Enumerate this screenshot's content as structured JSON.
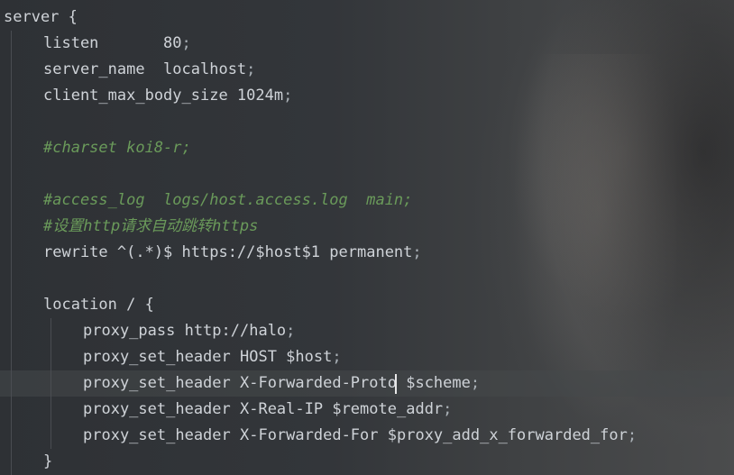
{
  "editor": {
    "lines": [
      {
        "indent": 0,
        "tokens": [
          {
            "t": "server {",
            "c": "kw"
          }
        ]
      },
      {
        "indent": 1,
        "tokens": [
          {
            "t": "listen       80",
            "c": "kw"
          },
          {
            "t": ";",
            "c": "punct"
          }
        ]
      },
      {
        "indent": 1,
        "tokens": [
          {
            "t": "server_name  localhost",
            "c": "kw"
          },
          {
            "t": ";",
            "c": "punct"
          }
        ]
      },
      {
        "indent": 1,
        "tokens": [
          {
            "t": "client_max_body_size 1024m",
            "c": "kw"
          },
          {
            "t": ";",
            "c": "punct"
          }
        ]
      },
      {
        "indent": 1,
        "tokens": []
      },
      {
        "indent": 1,
        "tokens": [
          {
            "t": "#charset koi8-r;",
            "c": "comment"
          }
        ]
      },
      {
        "indent": 1,
        "tokens": []
      },
      {
        "indent": 1,
        "tokens": [
          {
            "t": "#access_log  logs/host.access.log  main;",
            "c": "comment"
          }
        ]
      },
      {
        "indent": 1,
        "tokens": [
          {
            "t": "#设置http请求自动跳转https",
            "c": "comment"
          }
        ]
      },
      {
        "indent": 1,
        "tokens": [
          {
            "t": "rewrite ^(.*)$ https://$host$1 permanent",
            "c": "kw"
          },
          {
            "t": ";",
            "c": "punct"
          }
        ]
      },
      {
        "indent": 1,
        "tokens": []
      },
      {
        "indent": 1,
        "tokens": [
          {
            "t": "location / {",
            "c": "kw"
          }
        ]
      },
      {
        "indent": 2,
        "tokens": [
          {
            "t": "proxy_pass http://halo",
            "c": "kw"
          },
          {
            "t": ";",
            "c": "punct"
          }
        ]
      },
      {
        "indent": 2,
        "tokens": [
          {
            "t": "proxy_set_header HOST $host",
            "c": "kw"
          },
          {
            "t": ";",
            "c": "punct"
          }
        ]
      },
      {
        "indent": 2,
        "current": true,
        "tokens": [
          {
            "t": "proxy_set_header X-Forwarded-Proto $scheme",
            "c": "kw"
          },
          {
            "t": ";",
            "c": "punct"
          }
        ]
      },
      {
        "indent": 2,
        "tokens": [
          {
            "t": "proxy_set_header X-Real-IP $remote_addr",
            "c": "kw"
          },
          {
            "t": ";",
            "c": "punct"
          }
        ]
      },
      {
        "indent": 2,
        "tokens": [
          {
            "t": "proxy_set_header X-Forwarded-For $proxy_add_x_forwarded_for",
            "c": "kw"
          },
          {
            "t": ";",
            "c": "punct"
          }
        ]
      },
      {
        "indent": 1,
        "tokens": [
          {
            "t": "}",
            "c": "kw"
          }
        ]
      }
    ]
  }
}
